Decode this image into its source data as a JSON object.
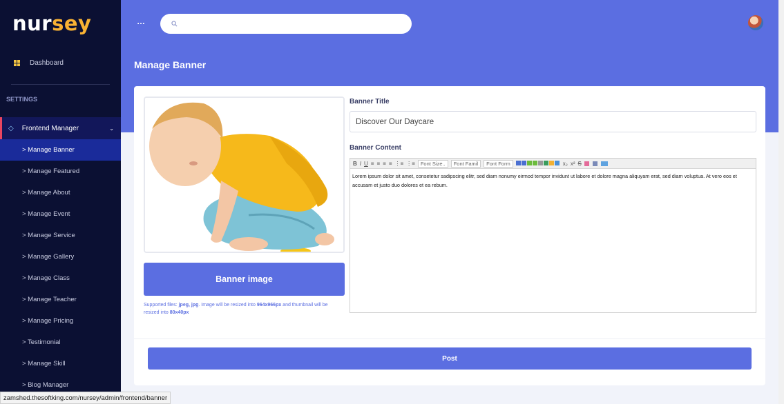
{
  "brand": {
    "part1": "nur",
    "part2": "sey"
  },
  "sidebar": {
    "dashboard": "Dashboard",
    "section": "SETTINGS",
    "group": "Frontend Manager",
    "items": [
      "> Manage Banner",
      "> Manage Featured",
      "> Manage About",
      "> Manage Event",
      "> Manage Service",
      "> Manage Gallery",
      "> Manage Class",
      "> Manage Teacher",
      "> Manage Pricing",
      "> Testimonial",
      "> Manage Skill",
      "> Blog Manager"
    ]
  },
  "topbar": {
    "menu_glyph": "…",
    "search_placeholder": ""
  },
  "page": {
    "title": "Manage Banner"
  },
  "form": {
    "banner_button": "Banner image",
    "hint_prefix": "Supported files: ",
    "hint_types": "jpeg, jpg",
    "hint_mid": ". Image will be resized into ",
    "hint_size": "964x966px",
    "hint_mid2": " and thumbnail will be resized into ",
    "hint_thumb": "80x40px",
    "title_label": "Banner Title",
    "title_value": "Discover Our Daycare",
    "content_label": "Banner Content",
    "toolbar": {
      "font_size": "Font Size..",
      "font_family": "Font Famil",
      "font_format": "Font Form"
    },
    "content_text": "Lorem ipsum dolor sit amet, consetetur sadipscing elitr, sed diam nonumy eirmod tempor invidunt ut labore et dolore magna aliquyam erat, sed diam voluptua. At vero eos et accusam et justo duo dolores et ea rebum.",
    "post_button": "Post"
  },
  "status_url": "zamshed.thesoftking.com/nursey/admin/frontend/banner",
  "colors": {
    "primary": "#5b6ee1",
    "sidebar": "#0b1033",
    "accent": "#f9b233"
  }
}
